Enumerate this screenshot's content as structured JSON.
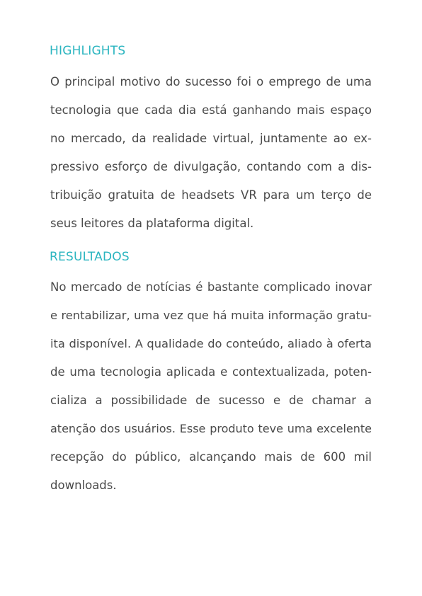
{
  "highlights": {
    "heading": "HIGHLIGHTS",
    "lines": [
      "O principal motivo do sucesso foi o emprego de uma",
      "tecnologia que cada dia está ganhando mais espaço",
      "no mercado, da realidade virtual, juntamente ao ex-",
      "pressivo esforço de divulgação, contando com a dis-",
      "tribuição gratuita de headsets VR para um terço de",
      "seus leitores da plataforma digital."
    ]
  },
  "resultados": {
    "heading": "RESULTADOS",
    "lines": [
      "No mercado de notícias é bastante complicado inovar",
      "e rentabilizar, uma vez que há muita informação gratu-",
      "ita disponível. A qualidade do conteúdo, aliado à oferta",
      "de uma tecnologia aplicada e contextualizada, poten-",
      "cializa a possibilidade de sucesso e de chamar a",
      "atenção dos usuários. Esse produto teve uma excelente",
      "recepção do público, alcançando mais de 600 mil",
      "downloads."
    ]
  }
}
